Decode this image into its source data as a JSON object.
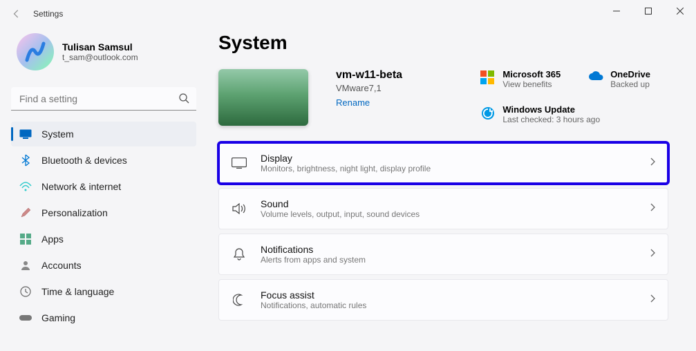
{
  "app_title": "Settings",
  "profile": {
    "name": "Tulisan Samsul",
    "email": "t_sam@outlook.com"
  },
  "search": {
    "placeholder": "Find a setting"
  },
  "nav": [
    {
      "label": "System"
    },
    {
      "label": "Bluetooth & devices"
    },
    {
      "label": "Network & internet"
    },
    {
      "label": "Personalization"
    },
    {
      "label": "Apps"
    },
    {
      "label": "Accounts"
    },
    {
      "label": "Time & language"
    },
    {
      "label": "Gaming"
    }
  ],
  "page_title": "System",
  "pc": {
    "name": "vm-w11-beta",
    "model": "VMware7,1",
    "rename": "Rename"
  },
  "services": {
    "m365": {
      "title": "Microsoft 365",
      "sub": "View benefits"
    },
    "onedrive": {
      "title": "OneDrive",
      "sub": "Backed up"
    },
    "update": {
      "title": "Windows Update",
      "sub": "Last checked: 3 hours ago"
    }
  },
  "cards": [
    {
      "title": "Display",
      "sub": "Monitors, brightness, night light, display profile"
    },
    {
      "title": "Sound",
      "sub": "Volume levels, output, input, sound devices"
    },
    {
      "title": "Notifications",
      "sub": "Alerts from apps and system"
    },
    {
      "title": "Focus assist",
      "sub": "Notifications, automatic rules"
    }
  ]
}
